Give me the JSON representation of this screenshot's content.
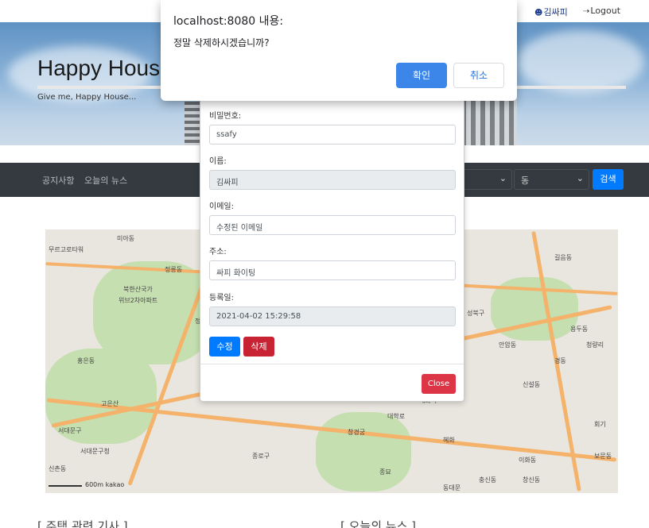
{
  "topbar": {
    "user_icon": "user-icon",
    "user_label": "김싸피",
    "logout_icon": "sign-out-icon",
    "logout_label": "Logout"
  },
  "hero": {
    "title": "Happy House",
    "subtitle": "Give me, Happy House..."
  },
  "nav": {
    "links": [
      "공지사항",
      "오늘의 뉴스"
    ],
    "dong_select": "동",
    "search_label": "검색"
  },
  "map": {
    "labels": [
      "무르고로타워",
      "미아동",
      "북한산국가",
      "위브2차아파트",
      "정릉동",
      "정릉",
      "종로구",
      "서대문구",
      "고은산",
      "신촌동",
      "홍은동",
      "서대문구청",
      "성북구",
      "대학로",
      "혜화",
      "창경궁",
      "종묘",
      "혜화역",
      "신설동",
      "용두동",
      "경동",
      "청량리",
      "회기",
      "이화동",
      "충신동",
      "창신동",
      "동대문",
      "보문동",
      "길음동",
      "안암동"
    ],
    "scale_label": "600m",
    "brand": "kakao"
  },
  "sections": {
    "left": "[ 주택 관련 기사 ]",
    "right": "[ 오늘의 뉴스 ]"
  },
  "modal": {
    "password_label": "비밀번호:",
    "password_value": "ssafy",
    "name_label": "이름:",
    "name_value": "김싸피",
    "email_label": "이메일:",
    "email_value": "수정된 이메일",
    "address_label": "주소:",
    "address_value": "싸피 화이팅",
    "regdate_label": "등록일:",
    "regdate_value": "2021-04-02 15:29:58",
    "edit_label": "수정",
    "delete_label": "삭제",
    "close_label": "Close"
  },
  "alert": {
    "title": "localhost:8080 내용:",
    "message": "정말 삭제하시겠습니까?",
    "ok_label": "확인",
    "cancel_label": "취소"
  },
  "colors": {
    "nav_bg": "#343a40",
    "primary": "#007bff",
    "danger": "#dc3545",
    "alert_ok": "#3b86e8"
  }
}
